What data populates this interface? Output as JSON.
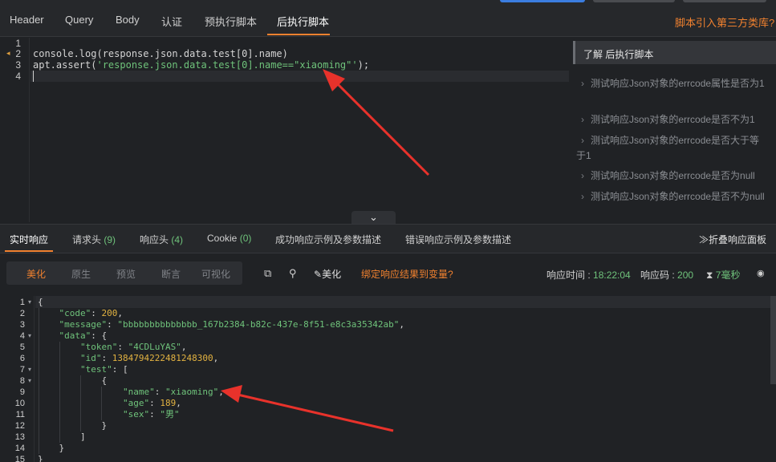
{
  "top_tabs": [
    "Header",
    "Query",
    "Body",
    "认证",
    "预执行脚本",
    "后执行脚本"
  ],
  "active_top_tab": "后执行脚本",
  "third_party_link": "脚本引入第三方类库?",
  "editor": {
    "line_numbers": [
      "1",
      "2",
      "3",
      "4"
    ],
    "line2": "console.log(response.json.data.test[0].name)",
    "line3_prefix": "apt.assert(",
    "line3_string": "'response.json.data.test[0].name==\"xiaoming\"'",
    "line3_suffix": ");"
  },
  "help_panel": {
    "title": "了解 后执行脚本",
    "items": [
      "测试响应Json对象的errcode属性是否为1",
      "测试响应Json对象的errcode是否不为1",
      "测试响应Json对象的errcode是否大于等于1",
      "测试响应Json对象的errcode是否为null",
      "测试响应Json对象的errcode是否不为null"
    ]
  },
  "response_tabs": {
    "realtime": "实时响应",
    "req_headers": "请求头",
    "req_headers_count": "(9)",
    "resp_headers": "响应头",
    "resp_headers_count": "(4)",
    "cookie": "Cookie",
    "cookie_count": "(0)",
    "success_example": "成功响应示例及参数描述",
    "error_example": "错误响应示例及参数描述",
    "fold_panel": "折叠响应面板"
  },
  "toolbar": {
    "view_modes": [
      "美化",
      "原生",
      "预览",
      "断言",
      "可视化"
    ],
    "selected_mode": "美化",
    "beautify": "美化",
    "bind_var": "绑定响应结果到变量?",
    "resp_time_label": "响应时间 : ",
    "resp_time": "18:22:04",
    "status_label": "响应码 : ",
    "status": "200",
    "duration": "7毫秒"
  },
  "json_lines": {
    "numbers": [
      "1",
      "2",
      "3",
      "4",
      "5",
      "6",
      "7",
      "8",
      "9",
      "10",
      "11",
      "12",
      "13",
      "14",
      "15"
    ],
    "code": "200",
    "message": "\"bbbbbbbbbbbbbb_167b2384-b82c-437e-8f51-e8c3a35342ab\"",
    "token": "\"4CDLuYAS\"",
    "id": "1384794222481248300",
    "name": "\"xiaoming\"",
    "age": "189",
    "sex": "\"男\""
  },
  "colors": {
    "accent": "#f0812f",
    "green": "#6fc37b",
    "number": "#e3b341",
    "arrow": "#e8322b"
  }
}
